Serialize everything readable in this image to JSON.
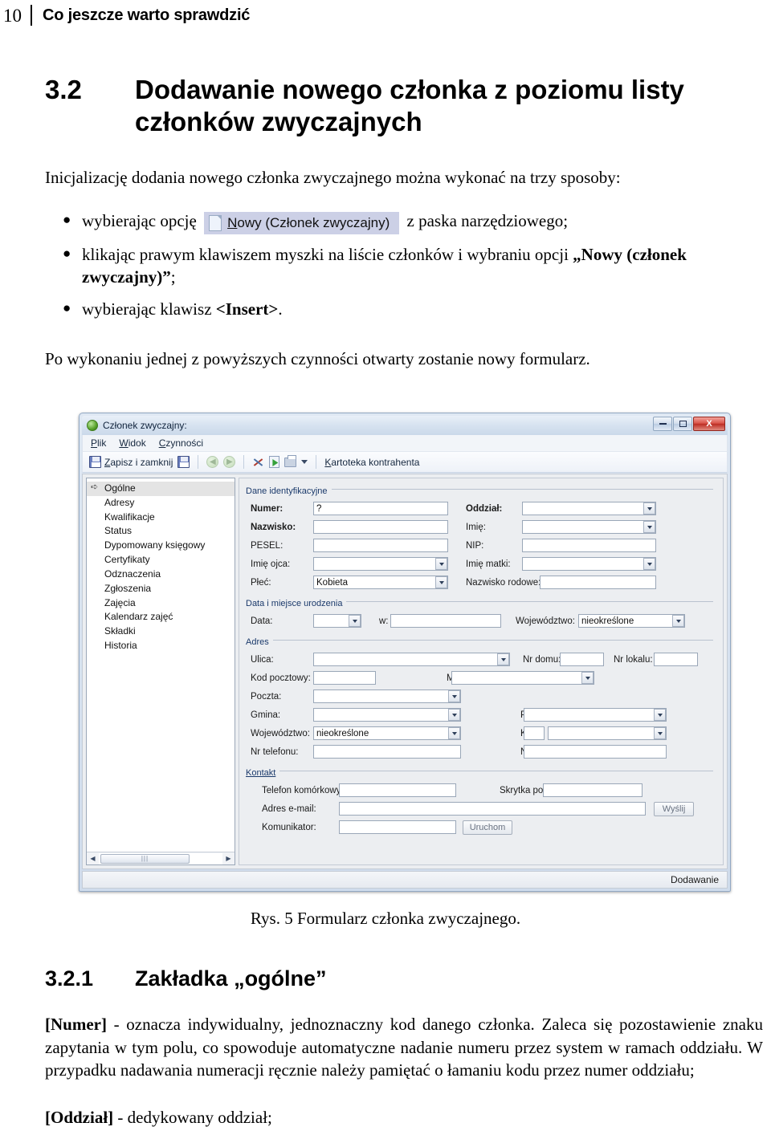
{
  "page": {
    "number": "10",
    "running_head": "Co jeszcze warto sprawdzić"
  },
  "section": {
    "number": "3.2",
    "title": "Dodawanie nowego członka z poziomu listy członków zwyczajnych",
    "intro": "Inicjalizację dodania nowego członka zwyczajnego można wykonać na trzy sposoby:"
  },
  "bullets": {
    "b1_before": "wybierając opcję",
    "b1_snippet_label_underlined": "N",
    "b1_snippet_label_rest": "owy (Członek zwyczajny)",
    "b1_after": "z paska narzędziowego;",
    "b2_text": "klikając prawym klawiszem myszki na liście członków i wybraniu opcji",
    "b2_bold": "„Nowy (członek zwyczajny)”",
    "b2_tail": ";",
    "b3_text": "wybierając klawisz",
    "b3_bold": "<Insert>",
    "b3_tail": "."
  },
  "after_bullets": "Po wykonaniu jednej z powyższych czynności otwarty zostanie nowy formularz.",
  "window": {
    "title": "Członek zwyczajny:",
    "buttons": {
      "minimize": "minimize-icon",
      "maximize": "maximize-icon",
      "close": "X"
    },
    "menu": [
      {
        "underlined": "P",
        "rest": "lik"
      },
      {
        "underlined": "W",
        "rest": "idok"
      },
      {
        "underlined": "C",
        "rest": "zynności"
      }
    ],
    "toolbar": {
      "save_close_underlined": "Z",
      "save_close_rest": "apisz i zamknij",
      "context_underlined": "K",
      "context_rest": "artoteka kontrahenta",
      "icons": [
        "save-icon",
        "save-as-icon",
        "back-arrow-icon",
        "forward-arrow-icon",
        "tools-icon",
        "refresh-icon",
        "print-icon",
        "print-dropdown-caret"
      ]
    },
    "tree": {
      "items": [
        "Ogólne",
        "Adresy",
        "Kwalifikacje",
        "Status",
        "Dypomowany księgowy",
        "Certyfikaty",
        "Odznaczenia",
        "Zgłoszenia",
        "Zajęcia",
        "Kalendarz zajęć",
        "Składki",
        "Historia"
      ],
      "selected_index": 0
    },
    "groups": {
      "identity": {
        "title": "Dane identyfikacyjne",
        "left": [
          {
            "label": "Numer:",
            "bold": true,
            "value": "?",
            "type": "text"
          },
          {
            "label": "Nazwisko:",
            "bold": true,
            "value": "",
            "type": "text"
          },
          {
            "label": "PESEL:",
            "bold": false,
            "value": "",
            "type": "text"
          },
          {
            "label": "Imię ojca:",
            "bold": false,
            "value": "",
            "type": "combo"
          },
          {
            "label": "Płeć:",
            "bold": false,
            "value": "Kobieta",
            "type": "combo"
          }
        ],
        "right": [
          {
            "label": "Oddział:",
            "bold": true,
            "value": "",
            "type": "combo"
          },
          {
            "label": "Imię:",
            "bold": false,
            "value": "",
            "type": "combo"
          },
          {
            "label": "NIP:",
            "bold": false,
            "value": "",
            "type": "text"
          },
          {
            "label": "Imię matki:",
            "bold": false,
            "value": "",
            "type": "combo"
          },
          {
            "label": "Nazwisko rodowe:",
            "bold": false,
            "value": "",
            "type": "text"
          }
        ]
      },
      "birth": {
        "title": "Data i miejsce urodzenia",
        "date_label": "Data:",
        "date_value": "",
        "in_label": "w:",
        "in_value": "",
        "voivodeship_label": "Województwo:",
        "voivodeship_value": "nieokreślone"
      },
      "address": {
        "title": "Adres",
        "street_label": "Ulica:",
        "street_value": "",
        "house_label": "Nr domu:",
        "house_value": "",
        "flat_label": "Nr lokalu:",
        "flat_value": "",
        "postal_label": "Kod pocztowy:",
        "postal_value": "",
        "city_label": "Miejscowość:",
        "city_value": "",
        "post_label": "Poczta:",
        "post_value": "",
        "commune_label": "Gmina:",
        "commune_value": "",
        "county_label": "Powiat:",
        "county_value": "",
        "voivodeship_label": "Województwo:",
        "voivodeship_value": "nieokreślone",
        "country_label": "Kraj:",
        "country_code": "",
        "country_value": "",
        "phone_label": "Nr telefonu:",
        "phone_value": "",
        "fax_label": "Nr faksu:",
        "fax_value": ""
      },
      "contact": {
        "title": "Kontakt",
        "mobile_label": "Telefon komórkowy:",
        "mobile_value": "",
        "pobox_label": "Skrytka pocztowa:",
        "pobox_value": "",
        "email_label": "Adres e-mail:",
        "email_value": "",
        "send_button": "Wyślij",
        "messenger_label": "Komunikator:",
        "messenger_value": "",
        "run_button": "Uruchom"
      }
    },
    "status": "Dodawanie"
  },
  "figure_caption": "Rys. 5 Formularz członka zwyczajnego.",
  "subsection": {
    "number": "3.2.1",
    "title": "Zakładka „ogólne”",
    "p1_bold": "[Numer]",
    "p1_text": " - oznacza indywidualny, jednoznaczny kod danego członka. Zaleca się pozostawienie znaku zapytania w tym polu, co spowoduje automatyczne nadanie numeru przez system w ramach oddziału. W przypadku nadawania numeracji ręcznie należy pamiętać o łamaniu kodu przez numer oddziału;",
    "p2_bold": "[Oddział]",
    "p2_text": " - dedykowany oddział;"
  }
}
